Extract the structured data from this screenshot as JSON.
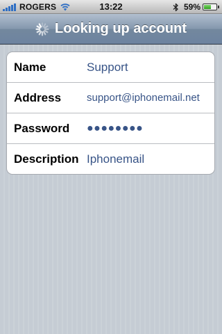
{
  "status_bar": {
    "carrier": "ROGERS",
    "time": "13:22",
    "battery_percent": "59%",
    "battery_level": 0.59,
    "signal_icon": "signal-bars-icon",
    "wifi_icon": "wifi-icon",
    "bluetooth_icon": "bluetooth-icon",
    "battery_icon": "battery-icon"
  },
  "nav_bar": {
    "title": "Looking up account",
    "activity_icon": "activity-spinner-icon"
  },
  "account_form": {
    "rows": [
      {
        "label": "Name",
        "value": "Support"
      },
      {
        "label": "Address",
        "value": "support@iphonemail.net"
      },
      {
        "label": "Password",
        "value": "●●●●●●●●"
      },
      {
        "label": "Description",
        "value": "Iphonemail"
      }
    ]
  },
  "colors": {
    "value_text": "#385487",
    "nav_bar": "#6d83a0",
    "background": "#c5ccd4"
  }
}
